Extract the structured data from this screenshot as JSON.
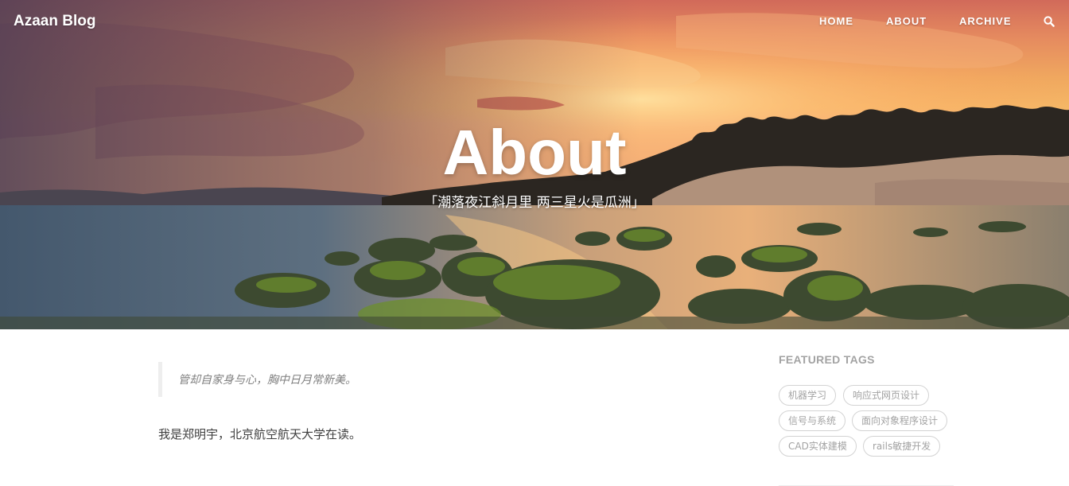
{
  "navbar": {
    "brand": "Azaan Blog",
    "links": [
      "HOME",
      "ABOUT",
      "ARCHIVE"
    ],
    "search_icon": "search-icon"
  },
  "hero": {
    "heading": "About",
    "subheading": "「潮落夜江斜月里  两三星火是瓜洲」"
  },
  "content": {
    "quote": "管却自家身与心，胸中日月常新美。",
    "intro": "我是郑明宇，北京航空航天大学在读。"
  },
  "sidebar": {
    "title": "FEATURED TAGS",
    "tags": [
      "机器学习",
      "响应式网页设计",
      "信号与系统",
      "面向对象程序设计",
      "CAD实体建模",
      "rails敏捷开发"
    ]
  },
  "colors": {
    "sky_top": "#d8735a",
    "sky_glow": "#f4b45d",
    "water": "#4b5f74",
    "tag_border": "#d3d3d3",
    "tag_text": "#a3a3a3",
    "heading_text": "#a3a3a3",
    "body_text": "#404040",
    "quote_text": "#808080"
  }
}
